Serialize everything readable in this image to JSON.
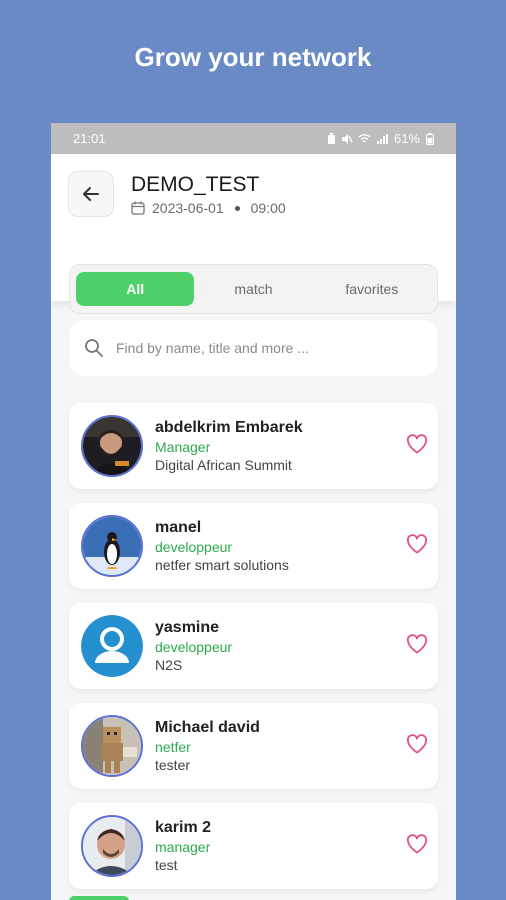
{
  "headline": "Grow your network",
  "status_bar": {
    "time": "21:01",
    "battery": "61%"
  },
  "event": {
    "title": "DEMO_TEST",
    "date": "2023-06-01",
    "time": "09:00"
  },
  "tabs": [
    {
      "label": "All",
      "active": true
    },
    {
      "label": "match",
      "active": false
    },
    {
      "label": "favorites",
      "active": false
    }
  ],
  "search": {
    "placeholder": "Find by name, title and more ..."
  },
  "contacts": [
    {
      "name": "abdelkrim Embarek",
      "role": "Manager",
      "org": "Digital African Summit"
    },
    {
      "name": "manel",
      "role": "developpeur",
      "org": "netfer smart solutions"
    },
    {
      "name": "yasmine",
      "role": "developpeur",
      "org": "N2S"
    },
    {
      "name": "Michael david",
      "role": "netfer",
      "org": "tester"
    },
    {
      "name": "karim 2",
      "role": "manager",
      "org": "test"
    }
  ],
  "colors": {
    "background": "#6a8ac6",
    "accent": "#4cd06a",
    "role_text": "#2ea84f",
    "heart": "#e0557a"
  }
}
